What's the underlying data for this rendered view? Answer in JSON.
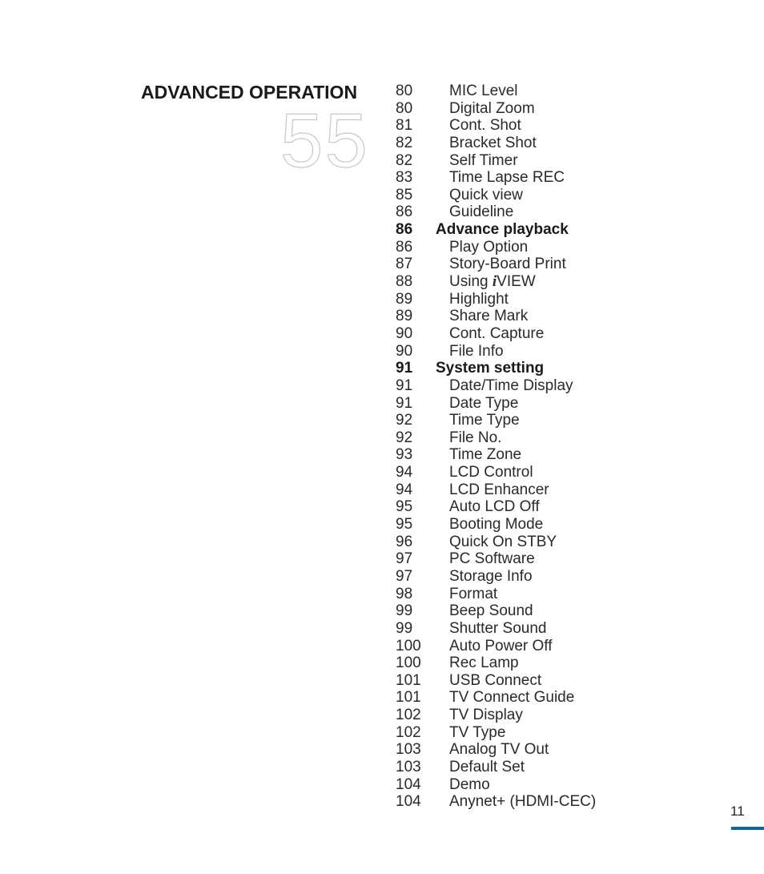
{
  "section": {
    "title": "ADVANCED OPERATION",
    "chapter_number": "55"
  },
  "toc": [
    {
      "page": "80",
      "label": "MIC Level",
      "heading": false
    },
    {
      "page": "80",
      "label": "Digital Zoom",
      "heading": false
    },
    {
      "page": "81",
      "label": "Cont. Shot",
      "heading": false
    },
    {
      "page": "82",
      "label": "Bracket Shot",
      "heading": false
    },
    {
      "page": "82",
      "label": "Self Timer",
      "heading": false
    },
    {
      "page": "83",
      "label": "Time Lapse REC",
      "heading": false
    },
    {
      "page": "85",
      "label": "Quick view",
      "heading": false
    },
    {
      "page": "86",
      "label": "Guideline",
      "heading": false
    },
    {
      "page": "86",
      "label": "Advance playback",
      "heading": true
    },
    {
      "page": "86",
      "label": "Play Option",
      "heading": false
    },
    {
      "page": "87",
      "label": "Story-Board Print",
      "heading": false
    },
    {
      "page": "88",
      "label": "Using iVIEW",
      "heading": false,
      "prefix": "Using ",
      "italic": "i",
      "suffix": "VIEW"
    },
    {
      "page": "89",
      "label": "Highlight",
      "heading": false
    },
    {
      "page": "89",
      "label": "Share Mark",
      "heading": false
    },
    {
      "page": "90",
      "label": "Cont. Capture",
      "heading": false
    },
    {
      "page": "90",
      "label": "File Info",
      "heading": false
    },
    {
      "page": "91",
      "label": "System setting",
      "heading": true
    },
    {
      "page": "91",
      "label": "Date/Time Display",
      "heading": false
    },
    {
      "page": "91",
      "label": "Date Type",
      "heading": false
    },
    {
      "page": "92",
      "label": "Time Type",
      "heading": false
    },
    {
      "page": "92",
      "label": "File No.",
      "heading": false
    },
    {
      "page": "93",
      "label": "Time Zone",
      "heading": false
    },
    {
      "page": "94",
      "label": "LCD Control",
      "heading": false
    },
    {
      "page": "94",
      "label": "LCD Enhancer",
      "heading": false
    },
    {
      "page": "95",
      "label": "Auto LCD Off",
      "heading": false
    },
    {
      "page": "95",
      "label": "Booting Mode",
      "heading": false
    },
    {
      "page": "96",
      "label": "Quick On STBY",
      "heading": false
    },
    {
      "page": "97",
      "label": "PC Software",
      "heading": false
    },
    {
      "page": "97",
      "label": "Storage Info",
      "heading": false
    },
    {
      "page": "98",
      "label": "Format",
      "heading": false
    },
    {
      "page": "99",
      "label": "Beep Sound",
      "heading": false
    },
    {
      "page": "99",
      "label": "Shutter Sound",
      "heading": false
    },
    {
      "page": "100",
      "label": "Auto Power Off",
      "heading": false
    },
    {
      "page": "100",
      "label": "Rec Lamp",
      "heading": false
    },
    {
      "page": "101",
      "label": "USB Connect",
      "heading": false
    },
    {
      "page": "101",
      "label": "TV Connect Guide",
      "heading": false
    },
    {
      "page": "102",
      "label": "TV Display",
      "heading": false
    },
    {
      "page": "102",
      "label": "TV Type",
      "heading": false
    },
    {
      "page": "103",
      "label": "Analog TV Out",
      "heading": false
    },
    {
      "page": "103",
      "label": "Default Set",
      "heading": false
    },
    {
      "page": "104",
      "label": "Demo",
      "heading": false
    },
    {
      "page": "104",
      "label": "Anynet+ (HDMI-CEC)",
      "heading": false
    }
  ],
  "footer": {
    "page_number": "11",
    "accent_color": "#0e6a9a"
  }
}
